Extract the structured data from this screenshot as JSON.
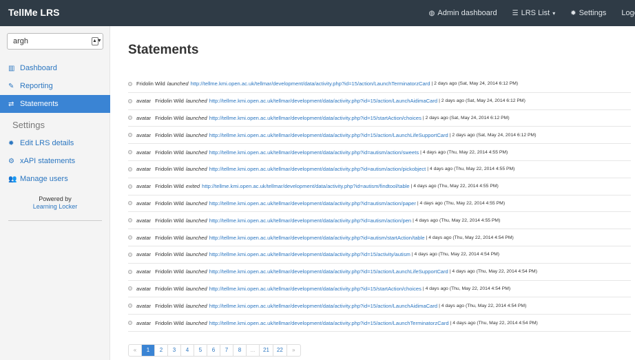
{
  "navbar": {
    "brand": "TellMe LRS",
    "items": [
      {
        "label": "Admin dashboard",
        "icon": "dashboard-icon",
        "glyph": "◍"
      },
      {
        "label": "LRS List",
        "icon": "list-icon",
        "glyph": "☰",
        "caret": "▾"
      },
      {
        "label": "Settings",
        "icon": "gear-icon",
        "glyph": "✹"
      },
      {
        "label": "Logout"
      }
    ]
  },
  "sidebar": {
    "select_value": "argh",
    "select_arrow": "▲▼",
    "menu": [
      {
        "label": "Dashboard",
        "glyph": "▥",
        "icon": "bar-chart-icon"
      },
      {
        "label": "Reporting",
        "glyph": "✎",
        "icon": "pencil-icon"
      },
      {
        "label": "Statements",
        "glyph": "⇄",
        "icon": "exchange-icon",
        "active": true
      }
    ],
    "settings_heading": "Settings",
    "settings_menu": [
      {
        "label": "Edit LRS details",
        "glyph": "✹",
        "icon": "gear-icon"
      },
      {
        "label": "xAPI statements",
        "glyph": "⚙",
        "icon": "gears-icon"
      },
      {
        "label": "Manage users",
        "glyph": "👥",
        "icon": "users-icon"
      }
    ],
    "powered_by": "Powered by",
    "powered_link": "Learning Locker"
  },
  "main": {
    "title": "Statements",
    "statements": [
      {
        "avatar": "",
        "actor": "Fridolin Wild",
        "verb": "launched",
        "url": "http://tellme.kmi.open.ac.uk/tellmar/development/data/activity.php?id=15/action/LaunchTerminatorzCard",
        "meta": "| 2 days ago (Sat, May 24, 2014 6:12 PM)"
      },
      {
        "avatar": "avatar",
        "actor": "Fridolin Wild",
        "verb": "launched",
        "url": "http://tellme.kmi.open.ac.uk/tellmar/development/data/activity.php?id=15/action/LaunchAidimaCard",
        "meta": "| 2 days ago (Sat, May 24, 2014 6:12 PM)"
      },
      {
        "avatar": "avatar",
        "actor": "Fridolin Wild",
        "verb": "launched",
        "url": "http://tellme.kmi.open.ac.uk/tellmar/development/data/activity.php?id=15/startAction/choices",
        "meta": "| 2 days ago (Sat, May 24, 2014 6:12 PM)"
      },
      {
        "avatar": "avatar",
        "actor": "Fridolin Wild",
        "verb": "launched",
        "url": "http://tellme.kmi.open.ac.uk/tellmar/development/data/activity.php?id=15/action/LaunchLifeSupportCard",
        "meta": "| 2 days ago (Sat, May 24, 2014 6:12 PM)"
      },
      {
        "avatar": "avatar",
        "actor": "Fridolin Wild",
        "verb": "launched",
        "url": "http://tellme.kmi.open.ac.uk/tellmar/development/data/activity.php?id=autism/action/sweets",
        "meta": "| 4 days ago (Thu, May 22, 2014 4:55 PM)"
      },
      {
        "avatar": "avatar",
        "actor": "Fridolin Wild",
        "verb": "launched",
        "url": "http://tellme.kmi.open.ac.uk/tellmar/development/data/activity.php?id=autism/action/pickobject",
        "meta": "| 4 days ago (Thu, May 22, 2014 4:55 PM)"
      },
      {
        "avatar": "avatar",
        "actor": "Fridolin Wild",
        "verb": "exited",
        "url": "http://tellme.kmi.open.ac.uk/tellmar/development/data/activity.php?id=autism/findtool/table",
        "meta": "| 4 days ago (Thu, May 22, 2014 4:55 PM)"
      },
      {
        "avatar": "avatar",
        "actor": "Fridolin Wild",
        "verb": "launched",
        "url": "http://tellme.kmi.open.ac.uk/tellmar/development/data/activity.php?id=autism/action/paper",
        "meta": "| 4 days ago (Thu, May 22, 2014 4:55 PM)"
      },
      {
        "avatar": "avatar",
        "actor": "Fridolin Wild",
        "verb": "launched",
        "url": "http://tellme.kmi.open.ac.uk/tellmar/development/data/activity.php?id=autism/action/pen",
        "meta": "| 4 days ago (Thu, May 22, 2014 4:55 PM)"
      },
      {
        "avatar": "avatar",
        "actor": "Fridolin Wild",
        "verb": "launched",
        "url": "http://tellme.kmi.open.ac.uk/tellmar/development/data/activity.php?id=autism/startAction/table",
        "meta": "| 4 days ago (Thu, May 22, 2014 4:54 PM)"
      },
      {
        "avatar": "avatar",
        "actor": "Fridolin Wild",
        "verb": "launched",
        "url": "http://tellme.kmi.open.ac.uk/tellmar/development/data/activity.php?id=15/activity/autism",
        "meta": "| 4 days ago (Thu, May 22, 2014 4:54 PM)"
      },
      {
        "avatar": "avatar",
        "actor": "Fridolin Wild",
        "verb": "launched",
        "url": "http://tellme.kmi.open.ac.uk/tellmar/development/data/activity.php?id=15/action/LaunchLifeSupportCard",
        "meta": "| 4 days ago (Thu, May 22, 2014 4:54 PM)"
      },
      {
        "avatar": "avatar",
        "actor": "Fridolin Wild",
        "verb": "launched",
        "url": "http://tellme.kmi.open.ac.uk/tellmar/development/data/activity.php?id=15/startAction/choices",
        "meta": "| 4 days ago (Thu, May 22, 2014 4:54 PM)"
      },
      {
        "avatar": "avatar",
        "actor": "Fridolin Wild",
        "verb": "launched",
        "url": "http://tellme.kmi.open.ac.uk/tellmar/development/data/activity.php?id=15/action/LaunchAidimaCard",
        "meta": "| 4 days ago (Thu, May 22, 2014 4:54 PM)"
      },
      {
        "avatar": "avatar",
        "actor": "Fridolin Wild",
        "verb": "launched",
        "url": "http://tellme.kmi.open.ac.uk/tellmar/development/data/activity.php?id=15/action/LaunchTerminatorzCard",
        "meta": "| 4 days ago (Thu, May 22, 2014 4:54 PM)"
      }
    ]
  },
  "pagination": {
    "pages": [
      "«",
      "1",
      "2",
      "3",
      "4",
      "5",
      "6",
      "7",
      "8",
      "...",
      "21",
      "22",
      "»"
    ],
    "active": "1"
  }
}
